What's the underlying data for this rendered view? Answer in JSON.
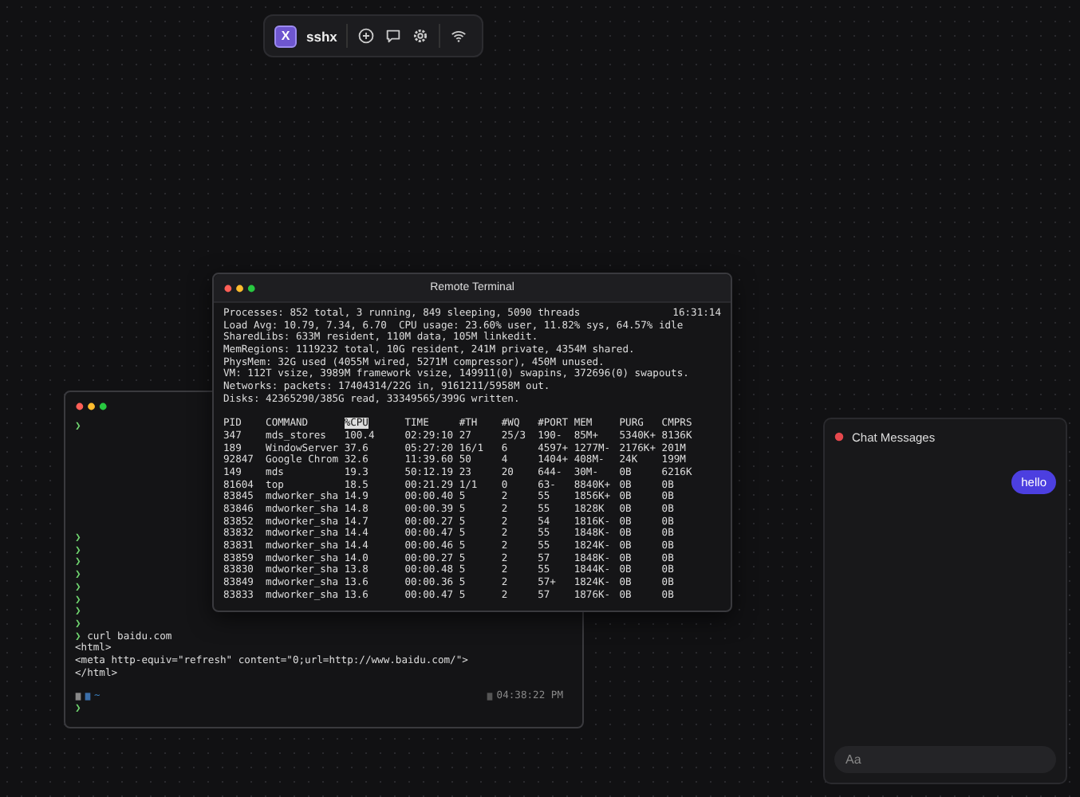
{
  "toolbar": {
    "app_name": "sshx",
    "logo_letter": "X"
  },
  "back_terminal": {
    "top_lines": [
      {
        "kind": "prompt",
        "prompt": "❯"
      }
    ],
    "bottom_lines": [
      {
        "kind": "prompt",
        "prompt": "❯"
      },
      {
        "kind": "prompt",
        "prompt": "❯"
      },
      {
        "kind": "prompt",
        "prompt": "❯"
      },
      {
        "kind": "prompt",
        "prompt": "❯"
      },
      {
        "kind": "prompt",
        "prompt": "❯"
      },
      {
        "kind": "prompt",
        "prompt": "❯"
      },
      {
        "kind": "prompt",
        "prompt": "❯"
      },
      {
        "kind": "prompt",
        "prompt": "❯"
      },
      {
        "kind": "prompt",
        "prompt": "❯",
        "text": "curl baidu.com"
      },
      {
        "kind": "output",
        "text": "<html>"
      },
      {
        "kind": "output",
        "text": "<meta http-equiv=\"refresh\" content=\"0;url=http://www.baidu.com/\">"
      },
      {
        "kind": "output",
        "text": "</html>"
      }
    ],
    "status": {
      "path": "~",
      "time": "04:38:22 PM"
    },
    "last_prompt": "❯"
  },
  "remote_terminal": {
    "title": "Remote Terminal",
    "clock": "16:31:14",
    "lines": [
      "Processes: 852 total, 3 running, 849 sleeping, 5090 threads",
      "Load Avg: 10.79, 7.34, 6.70  CPU usage: 23.60% user, 11.82% sys, 64.57% idle",
      "SharedLibs: 633M resident, 110M data, 105M linkedit.",
      "MemRegions: 1119232 total, 10G resident, 241M private, 4354M shared.",
      "PhysMem: 32G used (4055M wired, 5271M compressor), 450M unused.",
      "VM: 112T vsize, 3989M framework vsize, 149911(0) swapins, 372696(0) swapouts.",
      "Networks: packets: 17404314/22G in, 9161211/5958M out.",
      "Disks: 42365290/385G read, 33349565/399G written."
    ],
    "table": {
      "columns": [
        {
          "label": "PID",
          "selected": false
        },
        {
          "label": "COMMAND",
          "selected": false
        },
        {
          "label": "%CPU",
          "selected": true
        },
        {
          "label": "TIME",
          "selected": false
        },
        {
          "label": "#TH",
          "selected": false
        },
        {
          "label": "#WQ",
          "selected": false
        },
        {
          "label": "#PORT",
          "selected": false
        },
        {
          "label": "MEM",
          "selected": false
        },
        {
          "label": "PURG",
          "selected": false
        },
        {
          "label": "CMPRS",
          "selected": false
        }
      ],
      "rows": [
        [
          "347",
          "mds_stores",
          "100.4",
          "02:29:10",
          "27",
          "25/3",
          "190-",
          "85M+",
          "5340K+",
          "8136K"
        ],
        [
          "189",
          "WindowServer",
          "37.6",
          "05:27:20",
          "16/1",
          "6",
          "4597+",
          "1277M-",
          "2176K+",
          "201M"
        ],
        [
          "92847",
          "Google Chrom",
          "32.6",
          "11:39.60",
          "50",
          "4",
          "1404+",
          "408M-",
          "24K",
          "199M"
        ],
        [
          "149",
          "mds",
          "19.3",
          "50:12.19",
          "23",
          "20",
          "644-",
          "30M-",
          "0B",
          "6216K"
        ],
        [
          "81604",
          "top",
          "18.5",
          "00:21.29",
          "1/1",
          "0",
          "63-",
          "8840K+",
          "0B",
          "0B"
        ],
        [
          "83845",
          "mdworker_sha",
          "14.9",
          "00:00.40",
          "5",
          "2",
          "55",
          "1856K+",
          "0B",
          "0B"
        ],
        [
          "83846",
          "mdworker_sha",
          "14.8",
          "00:00.39",
          "5",
          "2",
          "55",
          "1828K",
          "0B",
          "0B"
        ],
        [
          "83852",
          "mdworker_sha",
          "14.7",
          "00:00.27",
          "5",
          "2",
          "54",
          "1816K-",
          "0B",
          "0B"
        ],
        [
          "83832",
          "mdworker_sha",
          "14.4",
          "00:00.47",
          "5",
          "2",
          "55",
          "1848K-",
          "0B",
          "0B"
        ],
        [
          "83831",
          "mdworker_sha",
          "14.4",
          "00:00.46",
          "5",
          "2",
          "55",
          "1824K-",
          "0B",
          "0B"
        ],
        [
          "83859",
          "mdworker_sha",
          "14.0",
          "00:00.27",
          "5",
          "2",
          "57",
          "1848K-",
          "0B",
          "0B"
        ],
        [
          "83830",
          "mdworker_sha",
          "13.8",
          "00:00.48",
          "5",
          "2",
          "55",
          "1844K-",
          "0B",
          "0B"
        ],
        [
          "83849",
          "mdworker_sha",
          "13.6",
          "00:00.36",
          "5",
          "2",
          "57+",
          "1824K-",
          "0B",
          "0B"
        ],
        [
          "83833",
          "mdworker_sha",
          "13.6",
          "00:00.47",
          "5",
          "2",
          "57",
          "1876K-",
          "0B",
          "0B"
        ]
      ]
    }
  },
  "chat": {
    "title": "Chat Messages",
    "messages": [
      {
        "text": "hello"
      }
    ],
    "input": {
      "placeholder": "Aa"
    }
  }
}
